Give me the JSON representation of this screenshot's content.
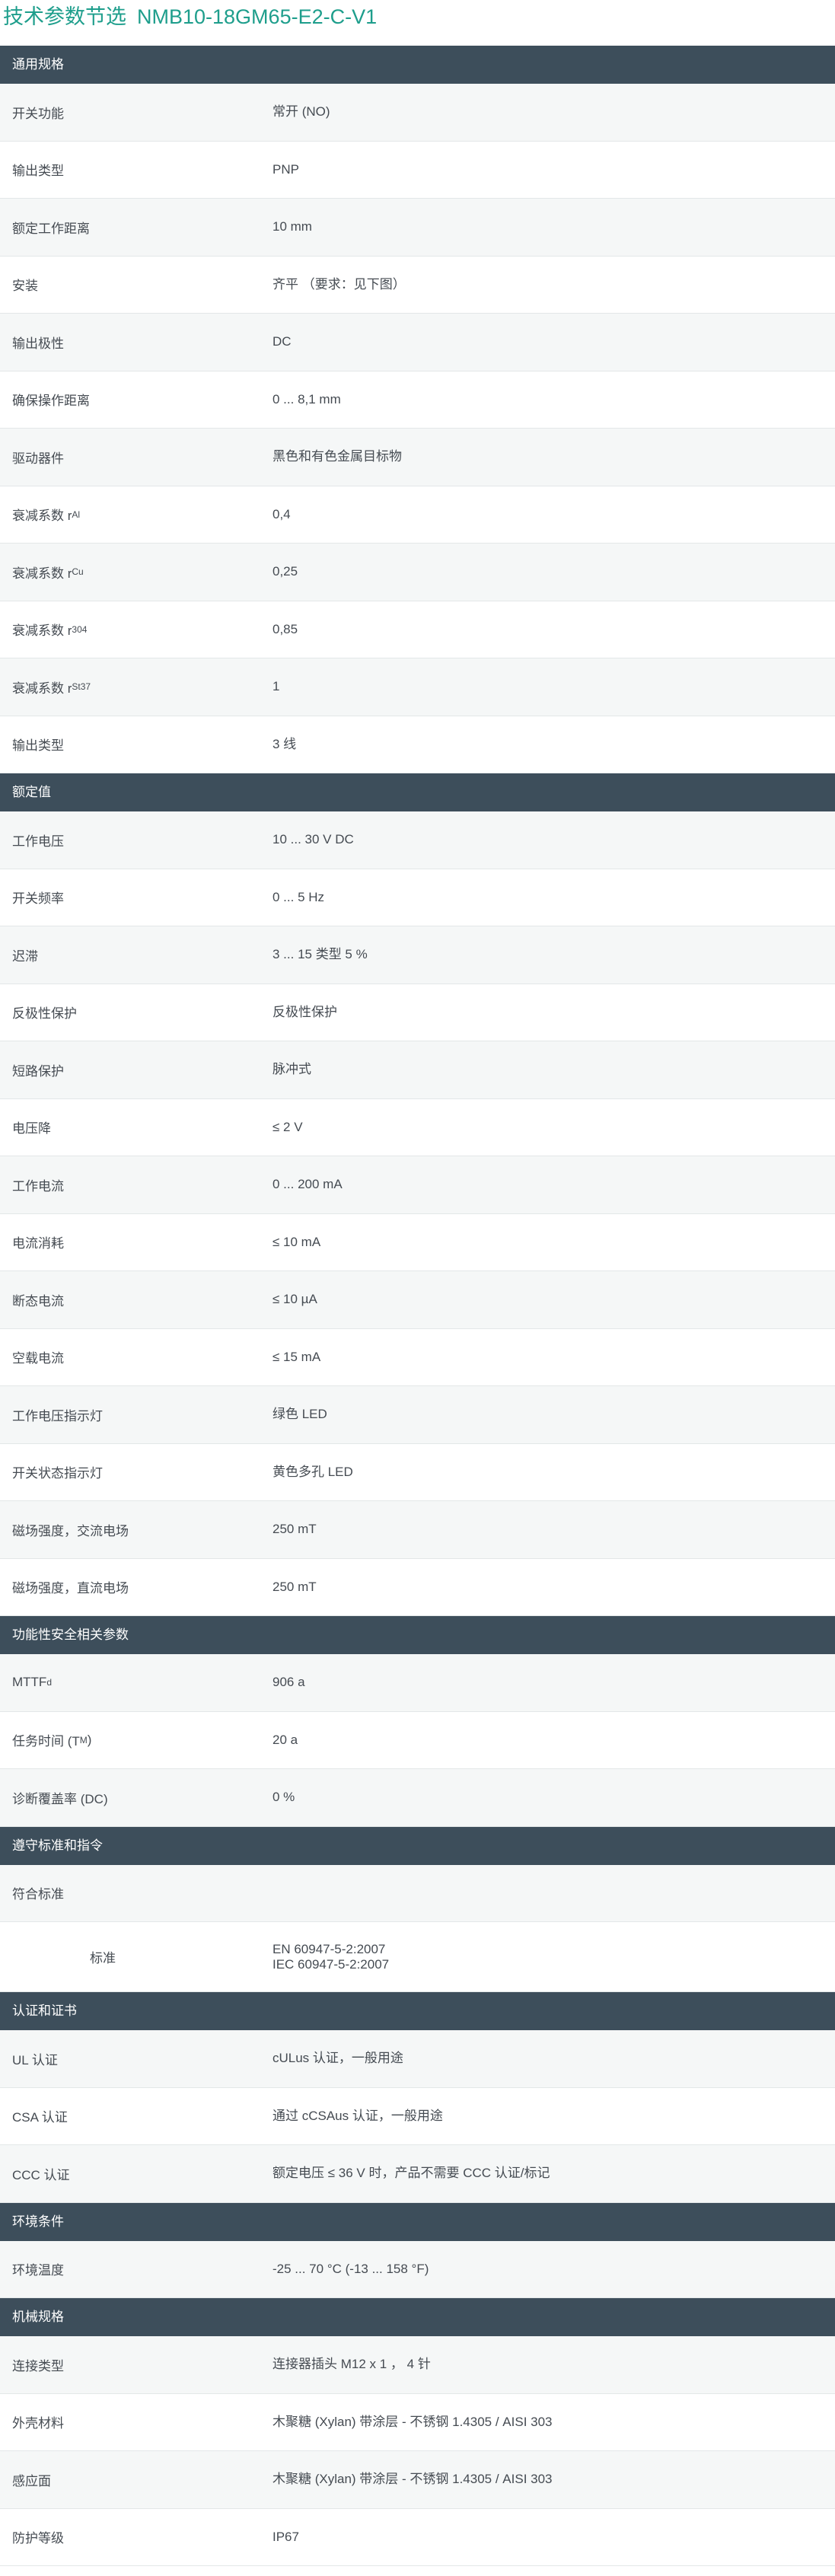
{
  "title": {
    "prefix": "技术参数节选",
    "model": "NMB10-18GM65-E2-C-V1"
  },
  "sections": [
    {
      "header": "通用规格",
      "rows": [
        {
          "label": "开关功能",
          "value": "常开 (NO)"
        },
        {
          "label": "输出类型",
          "value": "PNP"
        },
        {
          "label": "额定工作距离",
          "value": "10 mm"
        },
        {
          "label": "安装",
          "value": "齐平 （要求：见下图）"
        },
        {
          "label": "输出极性",
          "value": "DC"
        },
        {
          "label": "确保操作距离",
          "value": "0 ... 8,1 mm"
        },
        {
          "label": "驱动器件",
          "value": "黑色和有色金属目标物"
        },
        {
          "label": "衰减系数 r",
          "sub": "Al",
          "value": "0,4"
        },
        {
          "label": "衰减系数 r",
          "sub": "Cu",
          "value": "0,25"
        },
        {
          "label": "衰减系数 r",
          "sub": "304",
          "value": "0,85"
        },
        {
          "label": "衰减系数 r",
          "sub": "St37",
          "value": "1"
        },
        {
          "label": "输出类型",
          "value": "3 线"
        }
      ]
    },
    {
      "header": "额定值",
      "rows": [
        {
          "label": "工作电压",
          "value": "10 ... 30 V DC"
        },
        {
          "label": "开关频率",
          "value": "0 ... 5 Hz"
        },
        {
          "label": "迟滞",
          "value": "3 ... 15 类型 5 %"
        },
        {
          "label": "反极性保护",
          "value": "反极性保护"
        },
        {
          "label": "短路保护",
          "value": "脉冲式"
        },
        {
          "label": "电压降",
          "value": "≤ 2 V"
        },
        {
          "label": "工作电流",
          "value": "0 ... 200 mA"
        },
        {
          "label": "电流消耗",
          "value": "≤ 10 mA"
        },
        {
          "label": "断态电流",
          "value": "≤ 10 µA"
        },
        {
          "label": "空载电流",
          "value": "≤ 15 mA"
        },
        {
          "label": "工作电压指示灯",
          "value": "绿色 LED"
        },
        {
          "label": "开关状态指示灯",
          "value": "黄色多孔 LED"
        },
        {
          "label": "磁场强度，交流电场",
          "value": "250 mT"
        },
        {
          "label": "磁场强度，直流电场",
          "value": "250 mT"
        }
      ]
    },
    {
      "header": "功能性安全相关参数",
      "rows": [
        {
          "label": "MTTF",
          "sub": "d",
          "value": "906 a"
        },
        {
          "label": "任务时间 (T",
          "sub": "M",
          "suffix": ")",
          "value": "20 a"
        },
        {
          "label": "诊断覆盖率 (DC)",
          "value": "0 %"
        }
      ]
    },
    {
      "header": "遵守标准和指令",
      "rows": [
        {
          "label": "符合标准",
          "value": ""
        },
        {
          "label": "标准",
          "indent": true,
          "values": [
            "EN 60947-5-2:2007",
            "IEC 60947-5-2:2007"
          ]
        }
      ]
    },
    {
      "header": "认证和证书",
      "rows": [
        {
          "label": "UL 认证",
          "value": "cULus 认证，一般用途"
        },
        {
          "label": "CSA 认证",
          "value": "通过 cCSAus 认证，一般用途"
        },
        {
          "label": "CCC 认证",
          "value": "额定电压 ≤ 36 V 时，产品不需要 CCC 认证/标记"
        }
      ]
    },
    {
      "header": "环境条件",
      "rows": [
        {
          "label": "环境温度",
          "value": "-25 ... 70 °C (-13 ... 158 °F)"
        }
      ]
    },
    {
      "header": "机械规格",
      "rows": [
        {
          "label": "连接类型",
          "value": "连接器插头 M12 x 1 ， 4 针"
        },
        {
          "label": "外壳材料",
          "value": "木聚糖 (Xylan) 带涂层 - 不锈钢 1.4305 / AISI 303"
        },
        {
          "label": "感应面",
          "value": "木聚糖 (Xylan) 带涂层 - 不锈钢 1.4305 / AISI 303"
        },
        {
          "label": "防护等级",
          "value": "IP67"
        }
      ]
    }
  ]
}
